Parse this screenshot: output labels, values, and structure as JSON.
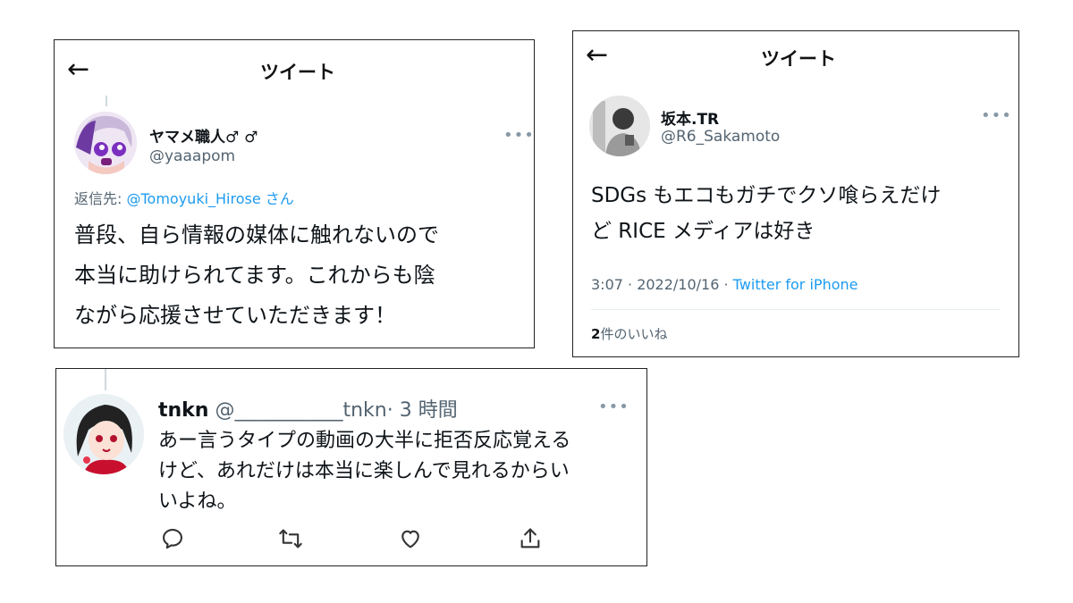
{
  "tweet_a": {
    "header_title": "ツイート",
    "back_icon": "left-arrow-icon",
    "author_name": "ヤマメ職人♂ ♂",
    "author_handle": "@yaaapom",
    "reply_prefix": "返信先: ",
    "reply_to": "@Tomoyuki_Hirose",
    "reply_suffix": " さん",
    "body_lines": [
      "普段、自ら情報の媒体に触れないので",
      "本当に助けられてます。これからも陰",
      "ながら応援させていただきます！"
    ],
    "more": "•••"
  },
  "tweet_b": {
    "header_title": "ツイート",
    "back_icon": "left-arrow-icon",
    "author_name": "坂本.TR",
    "author_handle": "@R6_Sakamoto",
    "body_lines": [
      "SDGs もエコもガチでクソ喰らえだけ",
      "ど RICE メディアは好き"
    ],
    "time_date": "3:07 · 2022/10/16 · ",
    "source": "Twitter for iPhone",
    "likes_count": "2",
    "likes_label": "件のいいね",
    "more": "•••"
  },
  "tweet_c": {
    "author_name": "tnkn",
    "author_handle": "@___________tnkn",
    "time": "· 3 時間",
    "body_lines": [
      "あー言うタイプの動画の大半に拒否反応覚える",
      "けど、あれだけは本当に楽しんで見れるからい",
      "いよね。"
    ],
    "more": "•••",
    "actions": [
      "reply-icon",
      "retweet-icon",
      "like-icon",
      "share-icon"
    ]
  },
  "colors": {
    "link": "#1d9bf0",
    "handle": "#536471",
    "border": "#222222"
  }
}
